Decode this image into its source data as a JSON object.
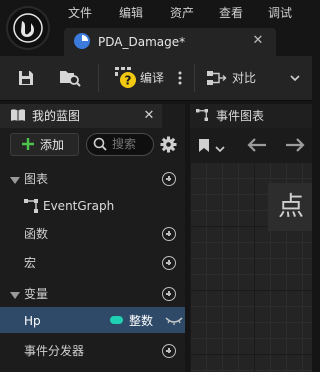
{
  "menu": {
    "items": [
      "文件",
      "编辑",
      "资产",
      "查看",
      "调试"
    ]
  },
  "document_tab": {
    "label": "PDA_Damage*"
  },
  "toolbar": {
    "compile_label": "编译",
    "diff_label": "对比"
  },
  "my_blueprint": {
    "title": "我的蓝图",
    "add_label": "添加",
    "search_placeholder": "搜索",
    "sections": {
      "graphs": "图表",
      "event_graph": "EventGraph",
      "functions": "函数",
      "macros": "宏",
      "variables": "变量",
      "variable_item": {
        "name": "Hp",
        "type": "整数",
        "type_color": "#1fd1b2"
      },
      "event_dispatchers": "事件分发器"
    }
  },
  "event_graph_tab": {
    "label": "事件图表"
  },
  "graph_overlay": {
    "text": "点"
  }
}
